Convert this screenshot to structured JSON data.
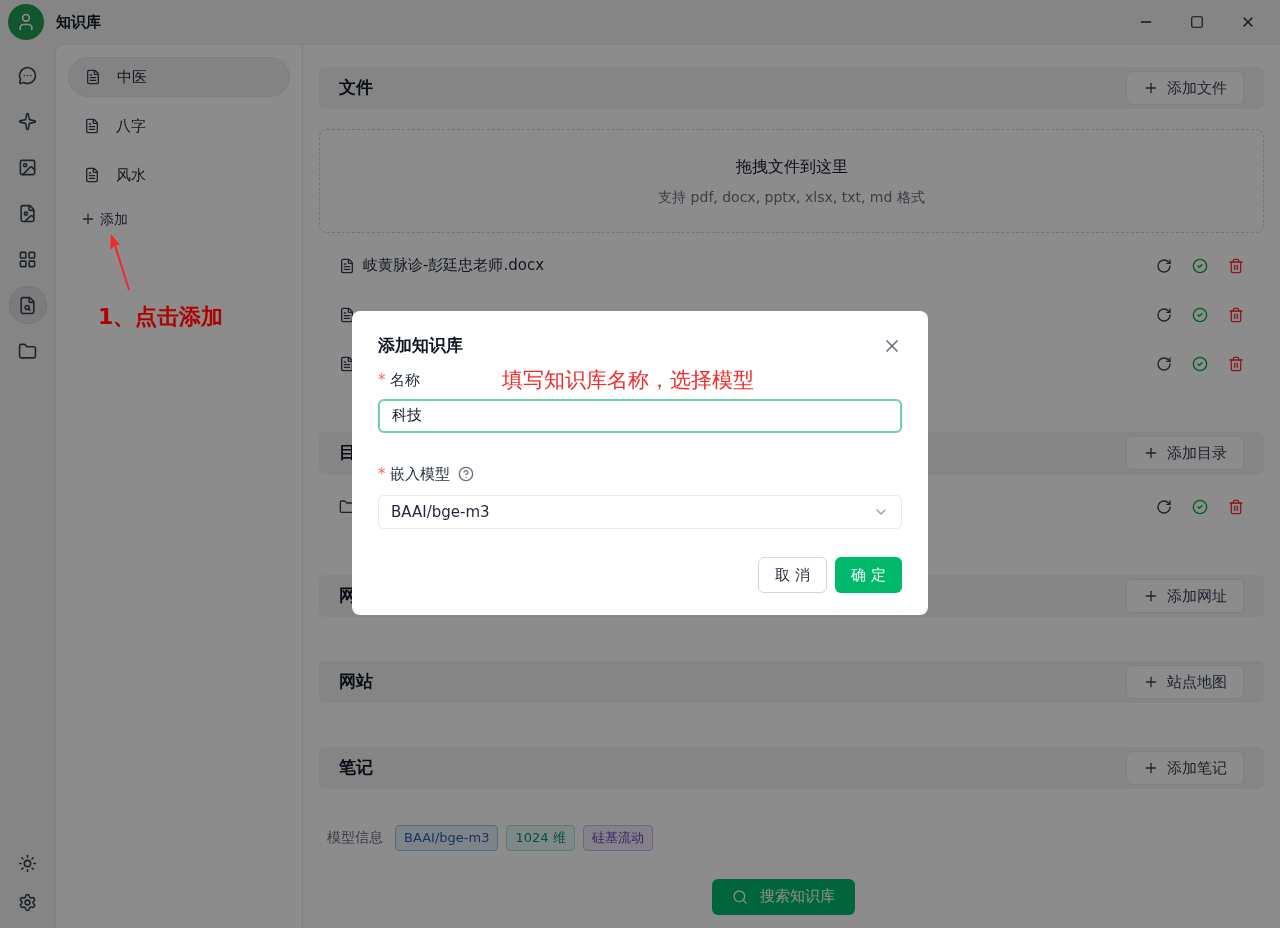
{
  "window": {
    "title": "知识库"
  },
  "rail_items": [
    {
      "selected": false
    },
    {
      "selected": false
    },
    {
      "selected": false
    },
    {
      "selected": false
    },
    {
      "selected": false
    },
    {
      "selected": true
    },
    {
      "selected": false
    }
  ],
  "knowledge_bases": [
    {
      "label": "中医",
      "selected": true
    },
    {
      "label": "八字",
      "selected": false
    },
    {
      "label": "风水",
      "selected": false
    }
  ],
  "add_label": "添加",
  "sections": [
    {
      "kind": "files",
      "title": "文件",
      "button": "添加文件",
      "drop": {
        "title": "拖拽文件到这里",
        "hint": "支持 pdf, docx, pptx, xlsx, txt, md 格式"
      },
      "items": [
        {
          "kind": "file",
          "name": "岐黄脉诊-彭廷忠老师.docx"
        },
        {
          "kind": "file"
        },
        {
          "kind": "file"
        }
      ]
    },
    {
      "kind": "list",
      "title": "目",
      "button": "添加目录",
      "items": [
        {
          "kind": "folder"
        }
      ]
    },
    {
      "kind": "list",
      "title": "网",
      "button": "添加网址"
    },
    {
      "kind": "list",
      "title": "网站",
      "button": "站点地图"
    },
    {
      "kind": "list",
      "title": "笔记",
      "button": "添加笔记"
    }
  ],
  "model_info": {
    "label": "模型信息",
    "tags": [
      {
        "kind": "model",
        "text": "BAAI/bge-m3"
      },
      {
        "kind": "dimension",
        "text": "1024 维"
      },
      {
        "kind": "provider",
        "text": "硅基流动"
      }
    ]
  },
  "search_button": "搜索知识库",
  "dialog": {
    "title": "添加知识库",
    "required_mark": "*",
    "name_label": "名称",
    "name_value": "科技",
    "model_label": "嵌入模型",
    "model_value": "BAAI/bge-m3",
    "cancel": "取 消",
    "ok": "确 定"
  },
  "annotations": [
    {
      "text": "1、点击添加"
    },
    {
      "text": "填写知识库名称，选择模型"
    }
  ]
}
